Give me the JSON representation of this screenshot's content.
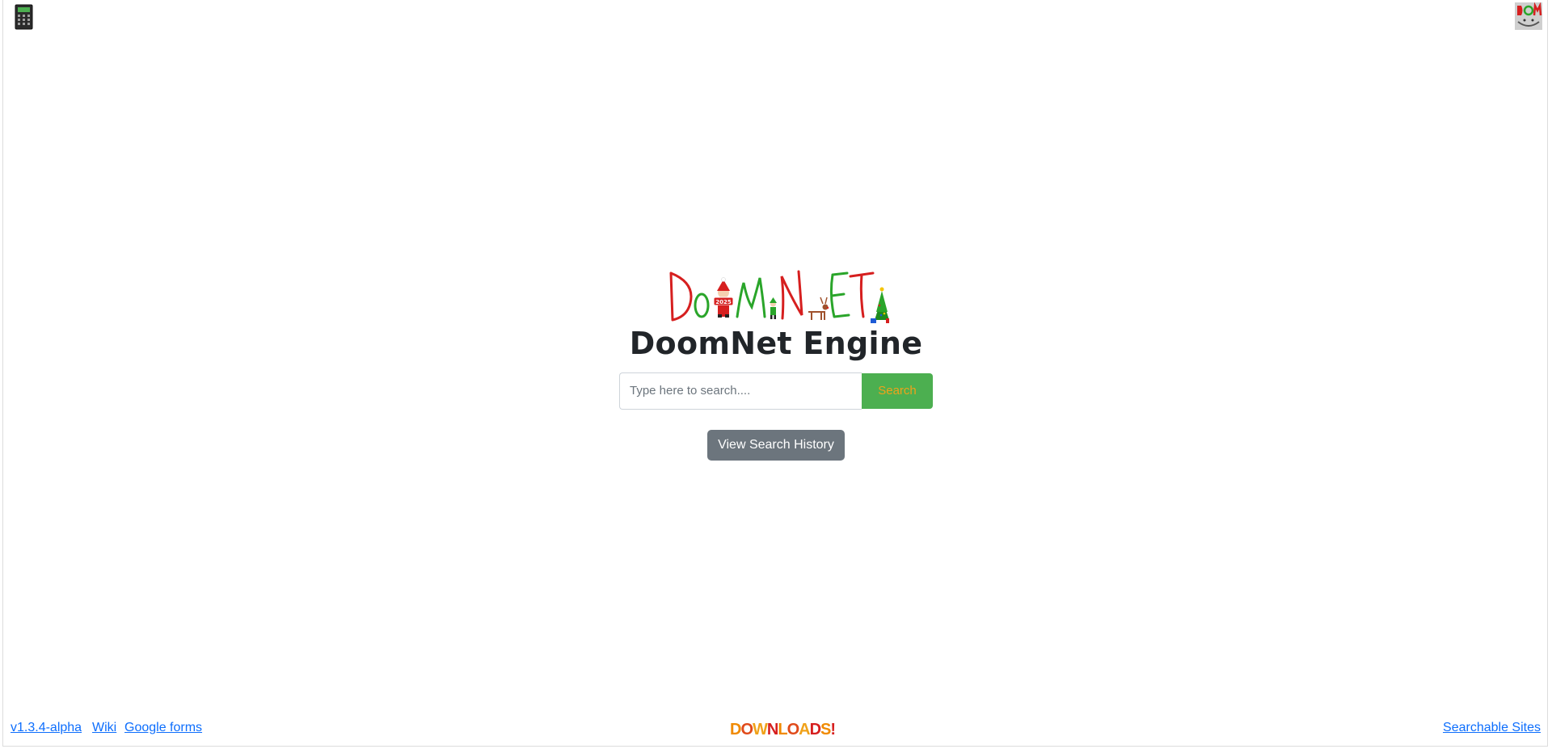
{
  "logo": {
    "text": "DoomNET",
    "colors": [
      "#d61f1f",
      "#2aa52a"
    ]
  },
  "title": "DoomNet Engine",
  "search": {
    "placeholder": "Type here to search....",
    "value": "",
    "button_label": "Search"
  },
  "history_button_label": "View Search History",
  "footer": {
    "version_label": "v1.3.4-alpha",
    "wiki_label": "Wiki",
    "forms_label": "Google forms",
    "downloads_label": "DOWNLOADS!",
    "searchable_sites_label": "Searchable Sites"
  },
  "colors": {
    "search_button_bg": "#4caf50",
    "search_button_text": "#f0a21a",
    "history_button_bg": "#6c757d",
    "link": "#0d6efd",
    "title": "#212529"
  },
  "icons": {
    "top_left": "calculator-icon",
    "top_right": "doom-avatar-icon"
  }
}
